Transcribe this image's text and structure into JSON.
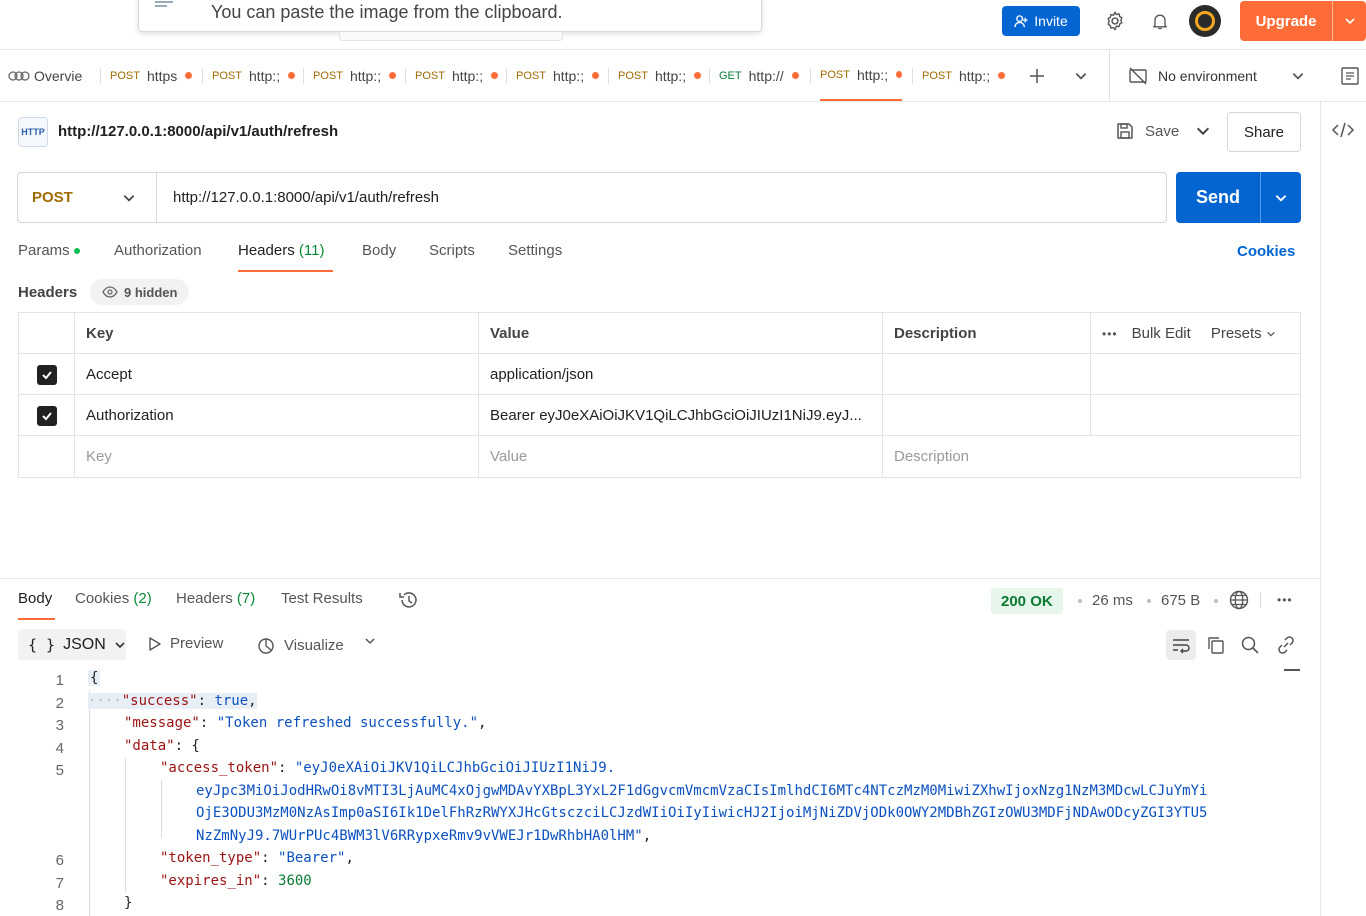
{
  "topbar": {
    "paste_message": "You can paste the image from the clipboard.",
    "invite_label": "Invite",
    "upgrade_label": "Upgrade",
    "icons": [
      "settings-icon",
      "bell-icon",
      "avatar",
      "chevron-down-icon"
    ]
  },
  "tabs": {
    "overview_label": "Overvie",
    "items": [
      {
        "method": "POST",
        "label": "https",
        "method_color": "#a06b00"
      },
      {
        "method": "POST",
        "label": "http:;",
        "method_color": "#a06b00"
      },
      {
        "method": "POST",
        "label": "http:;",
        "method_color": "#a06b00"
      },
      {
        "method": "POST",
        "label": "http:;",
        "method_color": "#a06b00"
      },
      {
        "method": "POST",
        "label": "http:;",
        "method_color": "#a06b00"
      },
      {
        "method": "POST",
        "label": "http:;",
        "method_color": "#a06b00"
      },
      {
        "method": "GET",
        "label": "http://",
        "method_color": "#0a7a34"
      },
      {
        "method": "POST",
        "label": "http:;",
        "method_color": "#a06b00",
        "active": true
      },
      {
        "method": "POST",
        "label": "http:;",
        "method_color": "#a06b00"
      }
    ],
    "environment": "No environment"
  },
  "request": {
    "title": "http://127.0.0.1:8000/api/v1/auth/refresh",
    "title_icon": "HTTP",
    "save_label": "Save",
    "share_label": "Share",
    "method": "POST",
    "url": "http://127.0.0.1:8000/api/v1/auth/refresh",
    "send_label": "Send",
    "subtabs": {
      "params": "Params",
      "authorization": "Authorization",
      "headers": "Headers",
      "headers_count": "(11)",
      "body": "Body",
      "scripts": "Scripts",
      "settings": "Settings"
    },
    "cookies_label": "Cookies",
    "headers_label": "Headers",
    "hidden_label": "9 hidden",
    "table": {
      "col_key": "Key",
      "col_value": "Value",
      "col_description": "Description",
      "bulk_edit": "Bulk Edit",
      "presets": "Presets",
      "rows": [
        {
          "key": "Accept",
          "value": "application/json",
          "checked": true
        },
        {
          "key": "Authorization",
          "value": "Bearer eyJ0eXAiOiJKV1QiLCJhbGciOiJIUzI1NiJ9.eyJ...",
          "checked": true
        }
      ],
      "placeholder_key": "Key",
      "placeholder_value": "Value",
      "placeholder_description": "Description"
    }
  },
  "response": {
    "tabs": {
      "body": "Body",
      "cookies": "Cookies",
      "cookies_count": "(2)",
      "headers": "Headers",
      "headers_count": "(7)",
      "test_results": "Test Results"
    },
    "status": "200 OK",
    "time": "26 ms",
    "size": "675 B",
    "format": "JSON",
    "preview_label": "Preview",
    "visualize_label": "Visualize",
    "line_numbers": [
      "1",
      "2",
      "3",
      "4",
      "5",
      "6",
      "7",
      "8"
    ],
    "json": {
      "open_brace": "{",
      "success_key": "\"success\"",
      "success_val": "true",
      "message_key": "\"message\"",
      "message_val": "\"Token refreshed successfully.\"",
      "data_key": "\"data\"",
      "access_token_key": "\"access_token\"",
      "access_token_lines": [
        "\"eyJ0eXAiOiJKV1QiLCJhbGciOiJIUzI1NiJ9.",
        "eyJpc3MiOiJodHRwOi8vMTI3LjAuMC4xOjgwMDAvYXBpL3YxL2F1dGgvcmVmcmVzaCIsImlhdCI6MTc4NTczMzM0MiwiZXhwIjoxNzg1NzM3MDcwLCJuYmYi",
        "OjE3ODU3MzM0NzAsImp0aSI6Ik1DelFhRzRWYXJHcGtsczciLCJzdWIiOiIyIiwicHJ2IjoiMjNiZDVjODk0OWY2MDBhZGIzOWU3MDFjNDAwODcyZGI3YTU5",
        "NzZmNyJ9.7WUrPUc4BWM3lV6RRypxeRmv9vVWEJr1DwRhbHA0lHM\""
      ],
      "token_type_key": "\"token_type\"",
      "token_type_val": "\"Bearer\"",
      "expires_in_key": "\"expires_in\"",
      "expires_in_val": "3600",
      "close_brace": "}"
    }
  }
}
